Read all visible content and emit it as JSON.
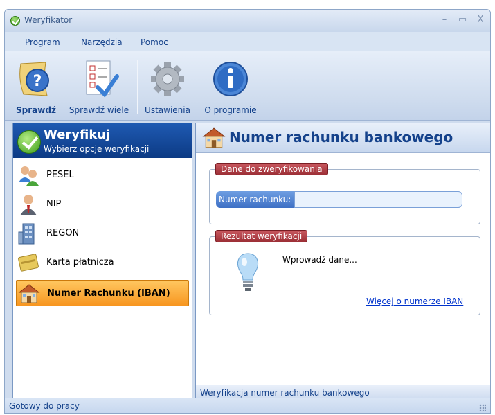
{
  "window": {
    "title": "Weryfikator",
    "minimize": "–",
    "maximize": "▭",
    "close": "X"
  },
  "menu": [
    "Program",
    "Narzędzia",
    "Pomoc"
  ],
  "ribbon": {
    "check": "Sprawdź",
    "check_many": "Sprawdź wiele",
    "settings": "Ustawienia",
    "about": "O programie"
  },
  "left": {
    "title": "Weryfikuj",
    "subtitle": "Wybierz opcje weryfikacji",
    "items": [
      {
        "label": "PESEL",
        "icon": "people-icon"
      },
      {
        "label": "NIP",
        "icon": "businessman-icon"
      },
      {
        "label": "REGON",
        "icon": "building-icon"
      },
      {
        "label": "Karta płatnicza",
        "icon": "payment-card-icon"
      },
      {
        "label": "Numer Rachunku (IBAN)",
        "icon": "bank-house-icon",
        "selected": true
      }
    ]
  },
  "right": {
    "title": "Numer rachunku bankowego",
    "data_group": "Dane do zweryfikowania",
    "account_label": "Numer rachunku:",
    "account_value": "",
    "result_group": "Rezultat weryfikacji",
    "result_text": "Wprowadź dane...",
    "iban_link": "Więcej o numerze IBAN",
    "footer": "Weryfikacja numer rachunku bankowego"
  },
  "status": "Gotowy do pracy",
  "colors": {
    "accent": "#15428b",
    "selected": "#f79620",
    "header": "#0c3a84",
    "group_title": "#9c2f36"
  }
}
